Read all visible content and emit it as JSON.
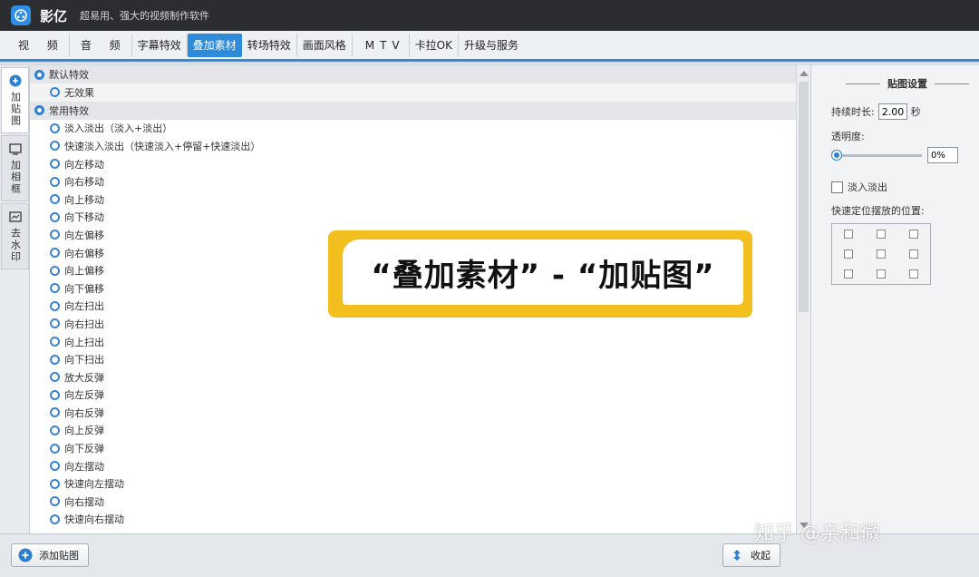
{
  "window": {
    "app_name": "影亿",
    "slogan": "超易用、强大的视频制作软件"
  },
  "tabs": [
    {
      "label": "视 频",
      "active": false
    },
    {
      "label": "音 频",
      "active": false
    },
    {
      "label": "字幕特效",
      "active": false
    },
    {
      "label": "叠加素材",
      "active": true
    },
    {
      "label": "转场特效",
      "active": false
    },
    {
      "label": "画面风格",
      "active": false
    },
    {
      "label": "MTV",
      "active": false
    },
    {
      "label": "卡拉OK",
      "active": false
    },
    {
      "label": "升级与服务",
      "active": false
    }
  ],
  "side_tabs": [
    {
      "label": "加贴图",
      "icon": "sticker-icon",
      "active": true
    },
    {
      "label": "加相框",
      "icon": "frame-icon",
      "active": false
    },
    {
      "label": "去水印",
      "icon": "watermark-icon",
      "active": false
    }
  ],
  "effects": {
    "groups": [
      {
        "header": "默认特效",
        "items": [
          "无效果"
        ]
      },
      {
        "header": "常用特效",
        "items": [
          "淡入淡出（淡入+淡出）",
          "快速淡入淡出（快速淡入+停留+快速淡出）",
          "向左移动",
          "向右移动",
          "向上移动",
          "向下移动",
          "向左偏移",
          "向右偏移",
          "向上偏移",
          "向下偏移",
          "向左扫出",
          "向右扫出",
          "向上扫出",
          "向下扫出",
          "放大反弹",
          "向左反弹",
          "向右反弹",
          "向上反弹",
          "向下反弹",
          "向左摆动",
          "快速向左摆动",
          "向右摆动",
          "快速向右摆动"
        ]
      }
    ]
  },
  "settings": {
    "title": "贴图设置",
    "duration_label": "持续时长:",
    "duration_value": "2.00",
    "duration_unit": "秒",
    "opacity_label": "透明度:",
    "opacity_value": "0%",
    "opacity_level": 0,
    "fade_label": "淡入淡出",
    "position_label": "快速定位摆放的位置:"
  },
  "bottom": {
    "add_sticker_label": "添加贴图",
    "collapse_label": "收起"
  },
  "annotation": {
    "text": "“叠加素材” - “加贴图”"
  },
  "watermark": {
    "text": "知乎 @亲和微"
  },
  "colors": {
    "accent": "#2e8bd9",
    "callout": "#f2bf1e"
  }
}
